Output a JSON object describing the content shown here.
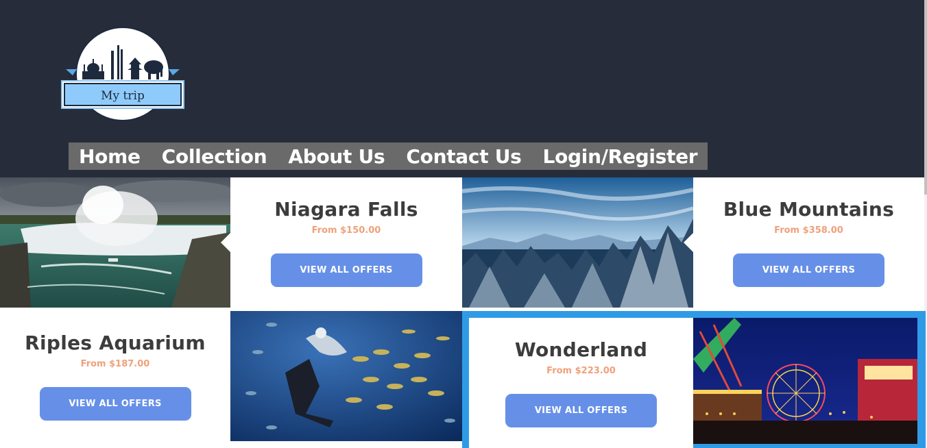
{
  "logo": {
    "text": "My trip",
    "icon": "city-skyline-logo"
  },
  "nav": [
    {
      "label": "Home"
    },
    {
      "label": "Collection"
    },
    {
      "label": "About Us"
    },
    {
      "label": "Contact Us"
    },
    {
      "label": "Login/Register"
    }
  ],
  "offers": [
    {
      "title": "Niagara Falls",
      "price": "From $150.00",
      "button": "VIEW ALL OFFERS"
    },
    {
      "title": "Blue Mountains",
      "price": "From $358.00",
      "button": "VIEW ALL OFFERS"
    },
    {
      "title": "Riples Aquarium",
      "price": "From $187.00",
      "button": "VIEW ALL OFFERS"
    },
    {
      "title": "Wonderland",
      "price": "From $223.00",
      "button": "VIEW ALL OFFERS"
    }
  ],
  "colors": {
    "header_bg": "#272c3a",
    "nav_bg": "#6a6a6a",
    "button": "#6690e8",
    "price": "#f0a07a",
    "highlight": "#2f9be6"
  }
}
